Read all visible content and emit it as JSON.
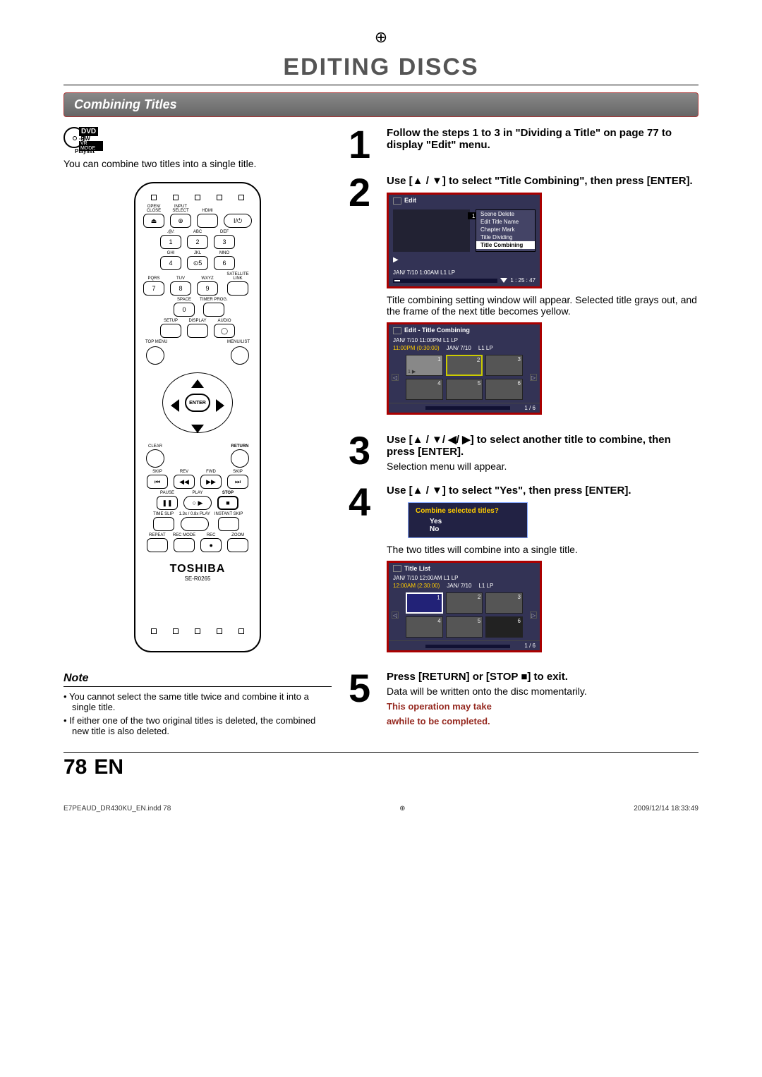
{
  "mainTitle": "EDITING DISCS",
  "sectionTitle": "Combining Titles",
  "dvdBadge": {
    "top": "DVD",
    "rw": "-RW",
    "mode": "VR MODE",
    "pl": "Playlist"
  },
  "intro": "You can combine two titles into a single title.",
  "remote": {
    "row1": {
      "openClose": "OPEN/\nCLOSE",
      "inputSelect": "INPUT\nSELECT",
      "hdmi": "HDMI",
      "power": "I/⏻"
    },
    "numLabels": {
      "at": ".@/:",
      "abc": "ABC",
      "def": "DEF",
      "ghi": "GHI",
      "jkl": "JKL",
      "mno": "MNO",
      "pqrs": "PQRS",
      "tuv": "TUV",
      "wxyz": "WXYZ",
      "space": "SPACE",
      "sat": "SATELLITE\nLINK",
      "timer": "TIMER\nPROG."
    },
    "nums": [
      "1",
      "2",
      "3",
      "4",
      "5",
      "6",
      "7",
      "8",
      "9",
      "0"
    ],
    "disp": {
      "setup": "SETUP",
      "display": "DISPLAY",
      "audio": "AUDIO"
    },
    "topMenu": "TOP MENU",
    "menuList": "MENU/LIST",
    "enter": "ENTER",
    "clear": "CLEAR",
    "return": "RETURN",
    "transport": {
      "skipL": "SKIP",
      "rev": "REV",
      "fwd": "FWD",
      "skipR": "SKIP",
      "pause": "PAUSE",
      "play": "PLAY",
      "stop": "STOP",
      "timeSlip": "TIME SLIP",
      "speedPlay": "1.3x / 0.8x PLAY",
      "instantSkip": "INSTANT SKIP",
      "repeat": "REPEAT",
      "recMode": "REC MODE",
      "rec": "REC",
      "zoom": "ZOOM"
    },
    "symbols": {
      "eject": "⏏",
      "skipPrev": "⏮",
      "rew": "◀◀",
      "ff": "▶▶",
      "skipNext": "⏭",
      "pause": "❚❚",
      "play": "▶",
      "stop": "■",
      "rec": "●",
      "cd": "◯"
    },
    "brand": "TOSHIBA",
    "model": "SE-R0265"
  },
  "steps": {
    "1": {
      "bold": "Follow the steps 1 to 3 in \"Dividing a Title\" on page 77 to display \"Edit\" menu."
    },
    "2": {
      "bold": "Use [▲ / ▼] to select \"Title Combining\", then press [ENTER].",
      "osd": {
        "title": "Edit",
        "menu": [
          "Scene Delete",
          "Edit Title Name",
          "Chapter Mark",
          "Title Dividing",
          "Title Combining"
        ],
        "info": "JAN/ 7/10 1:00AM L1   LP",
        "time": "1 : 25 : 47"
      },
      "after": "Title combining setting window will appear. Selected title grays out, and the frame of the next title becomes yellow.",
      "grid": {
        "title": "Edit - Title Combining",
        "line1": "JAN/ 7/10 11:00PM  L1   LP",
        "line2a": "11:00PM (0:30:00)",
        "line2b": "JAN/ 7/10",
        "line2c": "L1  LP",
        "thumbs": [
          "1",
          "2",
          "3",
          "4",
          "5",
          "6"
        ],
        "page": "1 / 6"
      }
    },
    "3": {
      "bold": "Use [▲ / ▼/ ◀/ ▶] to select another title to combine, then press [ENTER].",
      "after": "Selection menu will appear."
    },
    "4": {
      "bold": "Use [▲ / ▼] to select \"Yes\", then press [ENTER].",
      "dialog": {
        "q": "Combine selected titles?",
        "yes": "Yes",
        "no": "No"
      },
      "after": "The two titles will combine into a single title.",
      "grid": {
        "title": "Title List",
        "line1": "JAN/ 7/10 12:00AM  L1   LP",
        "line2a": "12:00AM (2:30:00)",
        "line2b": "JAN/ 7/10",
        "line2c": "L1 LP",
        "thumbs": [
          "1",
          "2",
          "3",
          "4",
          "5",
          "6"
        ],
        "page": "1 / 6"
      }
    },
    "5": {
      "bold": "Press [RETURN] or [STOP ■] to exit.",
      "after": "Data will be written onto the disc momentarily.",
      "warn1": "This operation may take",
      "warn2": "awhile to be completed."
    }
  },
  "note": {
    "heading": "Note",
    "items": [
      "You cannot select the same title twice and combine it into a single title.",
      "If either one of the two original titles is deleted, the combined new title is also deleted."
    ]
  },
  "pageNumber": "78",
  "pageLang": "EN",
  "fineL": "E7PEAUD_DR430KU_EN.indd   78",
  "fineR": "2009/12/14   18:33:49"
}
